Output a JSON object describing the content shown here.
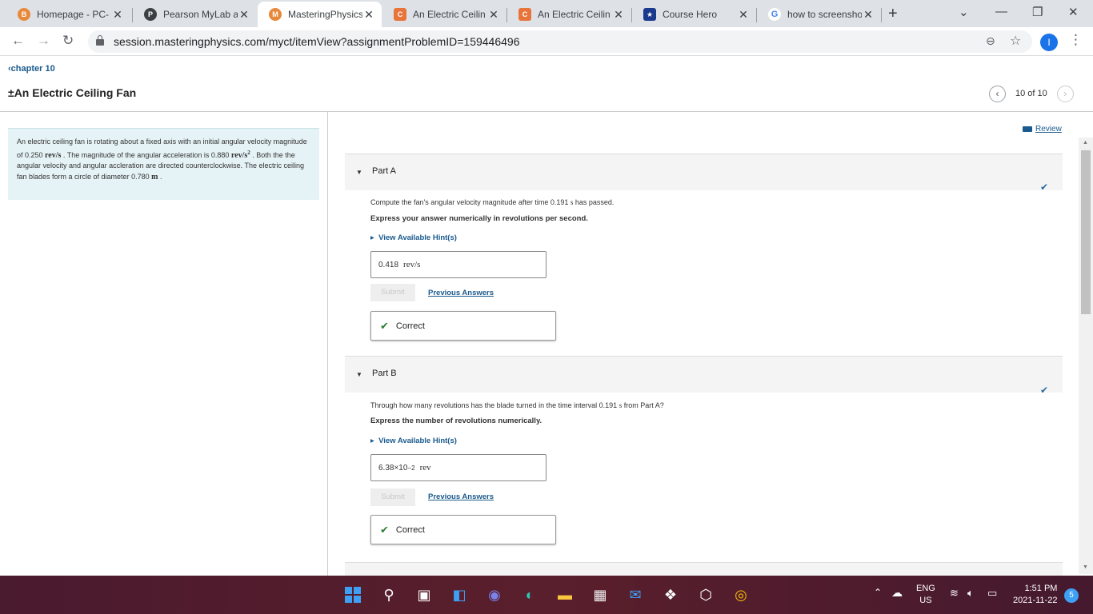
{
  "browser": {
    "tabs": [
      {
        "title": "Homepage - PC-",
        "favicon": "homepage-favicon",
        "color": "#e8883a",
        "glyph": "B"
      },
      {
        "title": "Pearson MyLab a",
        "favicon": "pearson-favicon",
        "color": "#3c4043",
        "glyph": "P"
      },
      {
        "title": "MasteringPhysics",
        "favicon": "mastering-favicon",
        "color": "#e8883a",
        "glyph": "M",
        "active": true
      },
      {
        "title": "An Electric Ceilin",
        "favicon": "chegg-favicon",
        "color": "#e8743a",
        "glyph": "C"
      },
      {
        "title": "An Electric Ceilin",
        "favicon": "chegg-favicon",
        "color": "#e8743a",
        "glyph": "C"
      },
      {
        "title": "Course Hero",
        "favicon": "coursehero-favicon",
        "color": "#1a3a8e",
        "glyph": "★"
      },
      {
        "title": "how to screensho",
        "favicon": "google-favicon",
        "color": "#ffffff",
        "glyph": "G"
      }
    ],
    "url": "session.masteringphysics.com/myct/itemView?assignmentProblemID=159446496",
    "profile_initial": "I"
  },
  "page": {
    "breadcrumb": "chapter 10",
    "title": "An Electric Ceiling Fan",
    "pager_text": "10 of 10",
    "review_label": "Review"
  },
  "problem": {
    "t1": "An electric ceiling fan is rotating about a fixed axis with an initial angular velocity magnitude of 0.250 ",
    "u1": "rev/s",
    "t2": " . The magnitude of the angular acceleration is 0.880 ",
    "u2": "rev/s",
    "u2_exp": "2",
    "t3": " . Both the the angular velocity and angular accleration are directed counterclockwise. The electric ceiling fan blades form a circle of diameter 0.780 ",
    "u3": "m",
    "t4": " ."
  },
  "parts": [
    {
      "label": "Part A",
      "question_pre": "Compute the fan's angular velocity magnitude after time 0.191 ",
      "question_unit": "s",
      "question_post": " has passed.",
      "instruction": "Express your answer numerically in revolutions per second.",
      "hint_label": "View Available Hint(s)",
      "answer_value": "0.418",
      "answer_exp": "",
      "answer_unit": "rev/s",
      "submit_label": "Submit",
      "previous_label": "Previous Answers",
      "feedback": "Correct"
    },
    {
      "label": "Part B",
      "question_pre": "Through how many revolutions has the blade turned in the time interval 0.191 ",
      "question_unit": "s",
      "question_post": " from Part A?",
      "instruction": "Express the number of revolutions numerically.",
      "hint_label": "View Available Hint(s)",
      "answer_value": "6.38×10",
      "answer_exp": "−2",
      "answer_unit": "rev",
      "submit_label": "Submit",
      "previous_label": "Previous Answers",
      "feedback": "Correct"
    }
  ],
  "taskbar": {
    "lang_top": "ENG",
    "lang_bottom": "US",
    "time": "1:51 PM",
    "date": "2021-11-22",
    "notifications": "5"
  },
  "colors": {
    "link": "#1a5a8e",
    "info_panel": "#e6f3f6",
    "correct_check": "#2e7d32"
  }
}
